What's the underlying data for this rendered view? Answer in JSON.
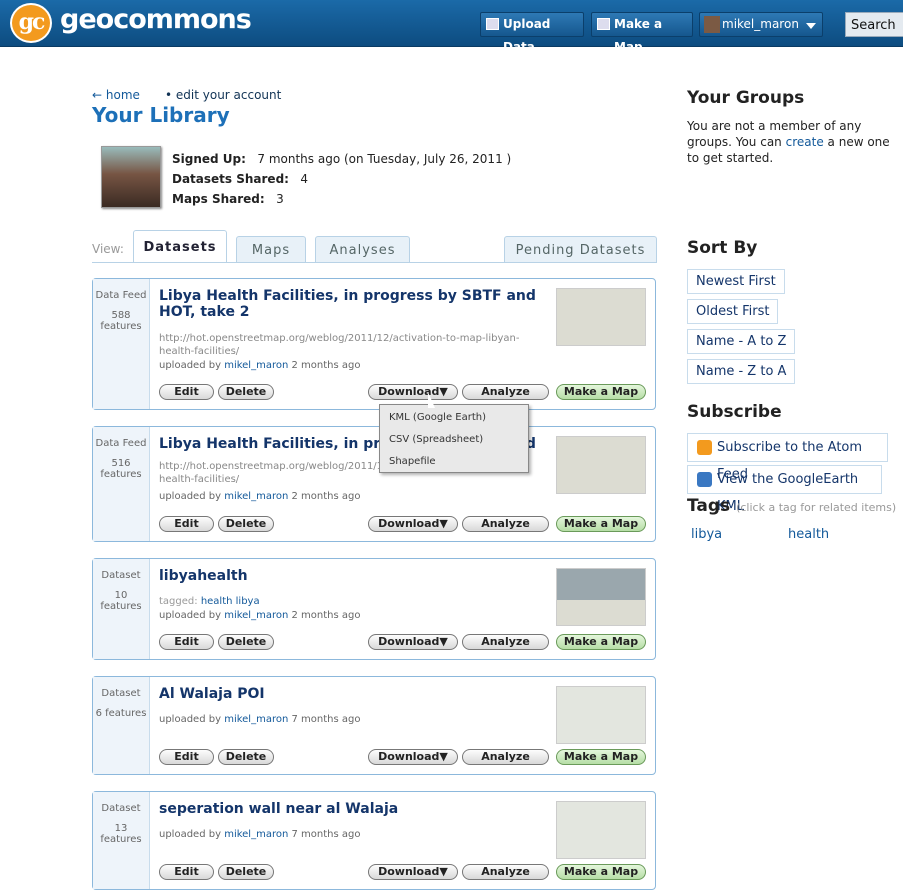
{
  "header": {
    "brand": "geocommons",
    "logo": "gc",
    "upload": "Upload Data",
    "make_map": "Make a Map",
    "user": "mikel_maron",
    "search": "Search"
  },
  "breadcrumb": {
    "home": "← home",
    "edit": "• edit your account"
  },
  "page_title": "Your Library",
  "profile": {
    "signed_up_label": "Signed Up:",
    "signed_up": "7 months ago (on Tuesday, July 26, 2011 )",
    "datasets_label": "Datasets Shared:",
    "datasets": "4",
    "maps_label": "Maps Shared:",
    "maps": "3"
  },
  "tabs": {
    "view": "View:",
    "datasets": "Datasets",
    "maps": "Maps",
    "analyses": "Analyses",
    "pending": "Pending Datasets"
  },
  "buttons": {
    "edit": "Edit",
    "delete": "Delete",
    "download": "Download▼",
    "analyze": "Analyze",
    "make_map": "Make a Map"
  },
  "cards": [
    {
      "type": "Data Feed",
      "count": "588",
      "count_label": "features",
      "title": "Libya Health Facilities, in progress by SBTF and HOT, take 2",
      "url": "http://hot.openstreetmap.org/weblog/2011/12/activation-to-map-libyan-health-facilities/",
      "up_prefix": "uploaded by",
      "user": "mikel_maron",
      "when": "2 months ago"
    },
    {
      "type": "Data Feed",
      "count": "516",
      "count_label": "features",
      "title": "Libya Health Facilities, in progress by SBTF and HOT",
      "url": "http://hot.openstreetmap.org/weblog/2011/12/activation-to-map-libyan-health-facilities/",
      "up_prefix": "uploaded by",
      "user": "mikel_maron",
      "when": "2 months ago"
    },
    {
      "type": "Dataset",
      "count": "10",
      "count_label": "features",
      "title": "libyahealth",
      "tags_label": "tagged:",
      "tags": "health libya",
      "up_prefix": "uploaded by",
      "user": "mikel_maron",
      "when": "2 months ago"
    },
    {
      "type": "Dataset",
      "count": "6 features",
      "title": "Al Walaja POI",
      "up_prefix": "uploaded by",
      "user": "mikel_maron",
      "when": "7 months ago"
    },
    {
      "type": "Dataset",
      "count": "13",
      "count_label": "features",
      "title": "seperation wall near al Walaja",
      "up_prefix": "uploaded by",
      "user": "mikel_maron",
      "when": "7 months ago"
    }
  ],
  "dropdown": [
    "KML (Google Earth)",
    "CSV (Spreadsheet)",
    "Shapefile"
  ],
  "groups": {
    "title": "Your Groups",
    "text_1": "You are not a member of any groups. You can",
    "link": "create",
    "text_2": "a new one to get started."
  },
  "sort": {
    "title": "Sort By",
    "items": [
      "Newest First",
      "Oldest First",
      "Name - A to Z",
      "Name - Z to A"
    ]
  },
  "subscribe": {
    "title": "Subscribe",
    "atom": "Subscribe to the Atom Feed",
    "kml": "View the GoogleEarth KML"
  },
  "tags": {
    "title": "Tags",
    "hint": "(click a tag for related items)",
    "items": [
      "libya",
      "health"
    ]
  },
  "colors": {
    "accent": "#1d70b8",
    "header": "#15578e",
    "rss": "#f39a1e"
  }
}
